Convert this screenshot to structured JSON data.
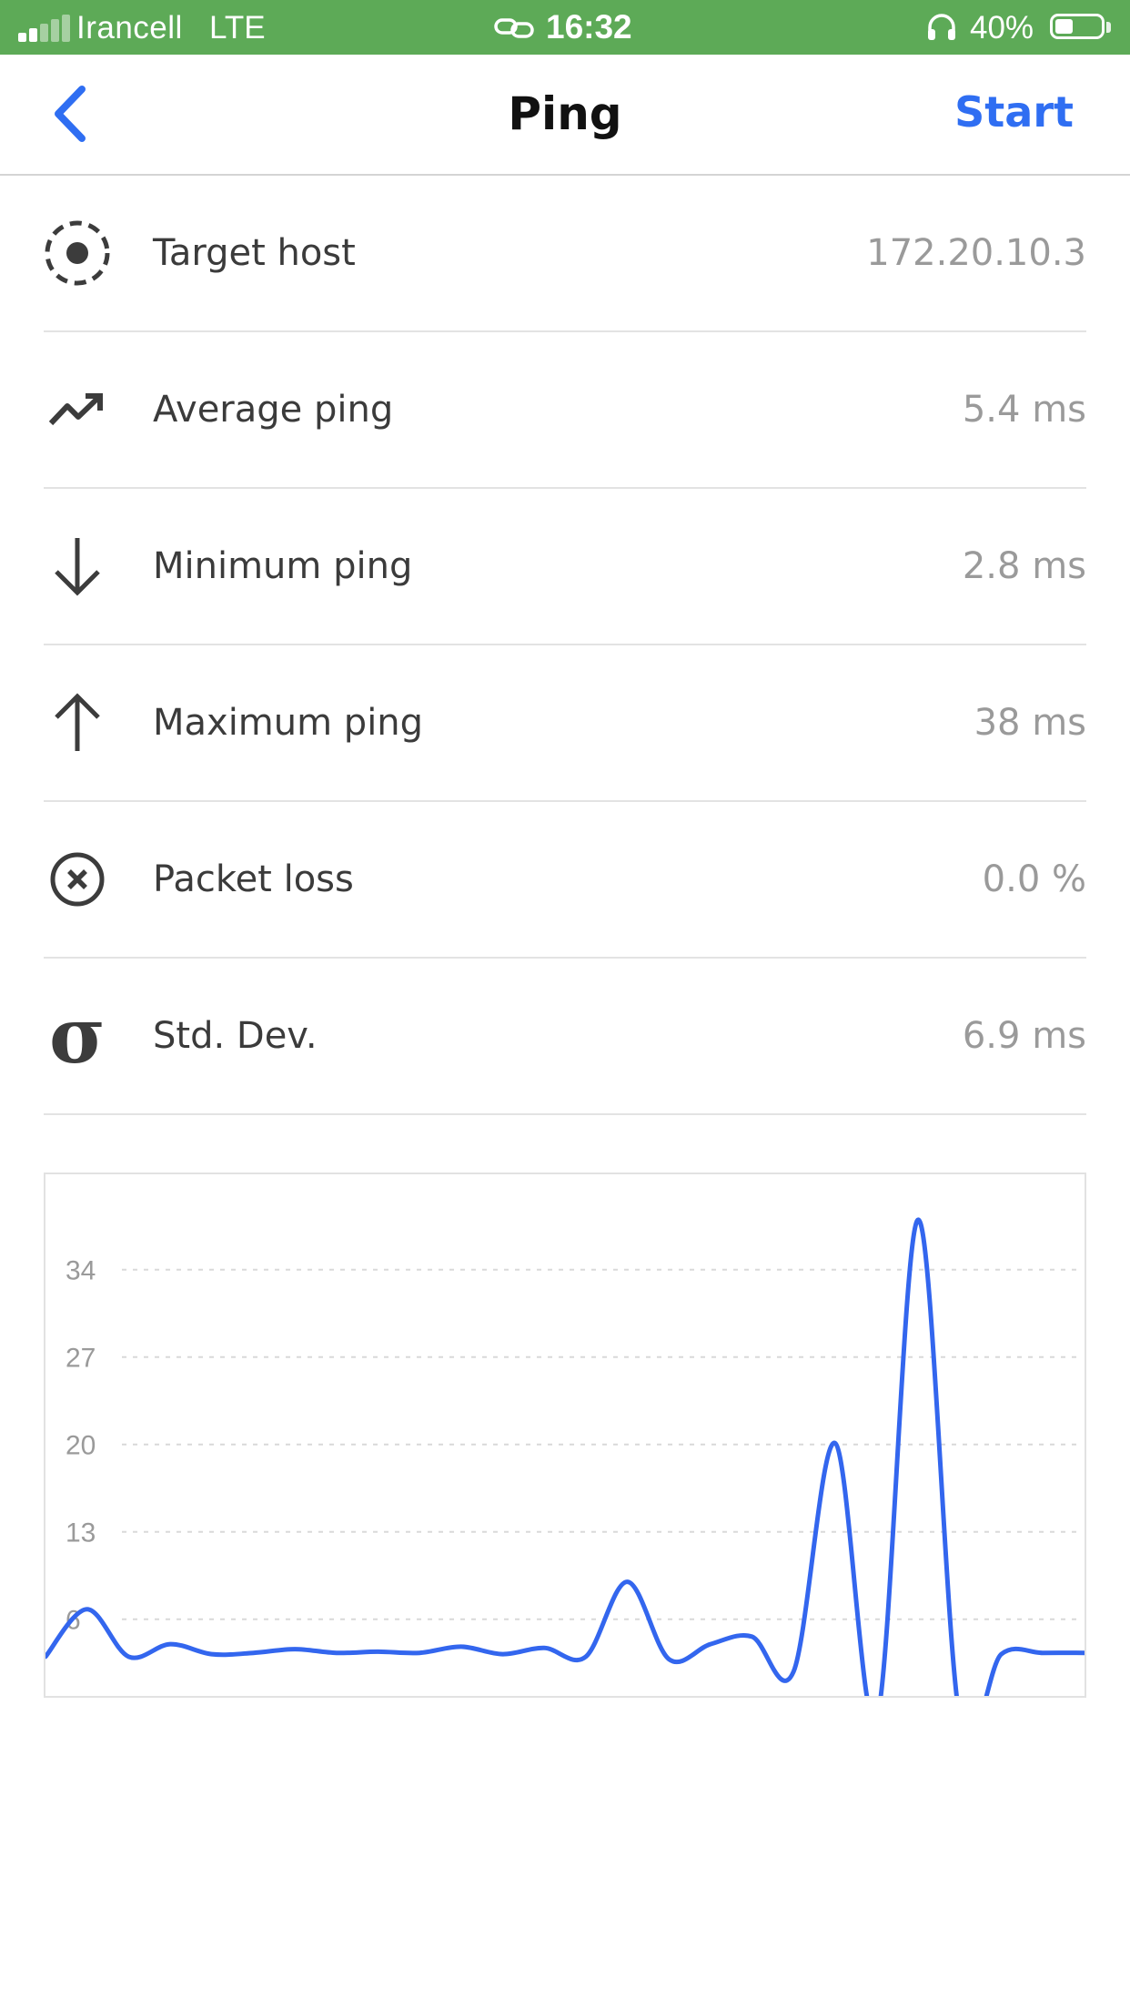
{
  "status_bar": {
    "carrier": "Irancell",
    "network": "LTE",
    "time": "16:32",
    "battery_percent": "40%",
    "battery_level": 0.4,
    "signal_bars_filled": 2,
    "background_color": "#5daa57"
  },
  "nav": {
    "back_icon": "chevron-left-icon",
    "title": "Ping",
    "start_label": "Start",
    "accent_color": "#2f6ef2"
  },
  "stats": [
    {
      "icon": "target-icon",
      "label": "Target host",
      "value": "172.20.10.3"
    },
    {
      "icon": "trending-up-icon",
      "label": "Average ping",
      "value": "5.4 ms"
    },
    {
      "icon": "arrow-down-icon",
      "label": "Minimum ping",
      "value": "2.8 ms"
    },
    {
      "icon": "arrow-up-icon",
      "label": "Maximum ping",
      "value": "38 ms"
    },
    {
      "icon": "close-circle-icon",
      "label": "Packet loss",
      "value": "0.0 %"
    },
    {
      "icon": "sigma-icon",
      "label": "Std. Dev.",
      "value": "6.9 ms",
      "glyph": "σ"
    }
  ],
  "chart_data": {
    "type": "line",
    "title": "",
    "xlabel": "",
    "ylabel": "",
    "y_ticks": [
      6,
      13,
      20,
      27,
      34
    ],
    "y_tick_labels": [
      "6",
      "13",
      "20",
      "27",
      "34"
    ],
    "ylim": [
      0,
      40
    ],
    "grid": true,
    "line_color": "#3366ee",
    "series": [
      {
        "values": [
          3,
          6.8,
          3,
          4,
          3.2,
          3.3,
          3.6,
          3.3,
          3.4,
          3.3,
          3.8,
          3.2,
          3.7,
          3,
          9,
          2.8,
          4,
          4.6,
          1.8,
          20.1,
          -2,
          38,
          -2,
          3.2,
          3.3,
          3.3
        ]
      }
    ]
  }
}
